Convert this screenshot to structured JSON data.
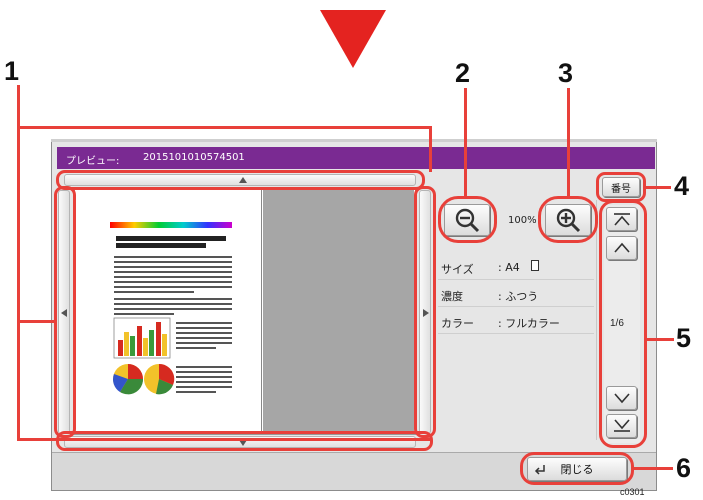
{
  "window": {
    "title_label": "プレビュー:",
    "job_id": "2015101010574501"
  },
  "zoom": {
    "level": "100%"
  },
  "info": [
    {
      "label": "サイズ",
      "value": ": A4"
    },
    {
      "label": "濃度",
      "value": ": ふつう"
    },
    {
      "label": "カラー",
      "value": ": フルカラー"
    }
  ],
  "page_nav": {
    "number_button": "番号",
    "page_indicator": "1/6"
  },
  "close_button": "閉じる",
  "figure_code": "c0301",
  "callouts": [
    "1",
    "2",
    "3",
    "4",
    "5",
    "6"
  ],
  "colors": {
    "title_bar": "#7a2a92",
    "callout_red": "#e8403a",
    "arrow_red": "#e42320"
  }
}
